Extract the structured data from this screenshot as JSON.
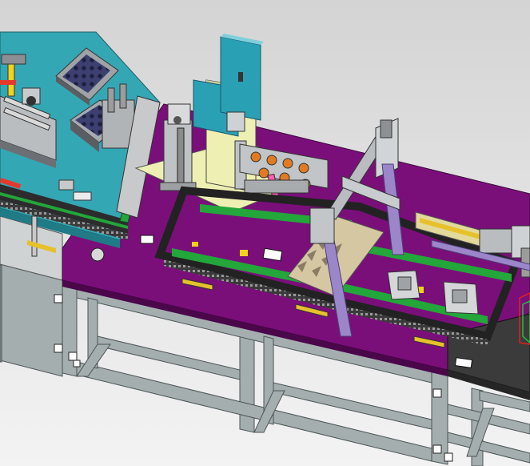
{
  "viewport": {
    "background": {
      "top": "#d4d4d4",
      "bottom": "#f3f3f3"
    }
  },
  "model": {
    "description_colors": {
      "table_top": "#7a0f7a",
      "frame": "#9aa4a6",
      "left_panel": "#34a7b4",
      "rail_green": "#23a63a",
      "rail_dark": "#2a2a2a",
      "yellow_pad": "#eef0b3",
      "lavender": "#9a86c9",
      "tan": "#d6c7a3",
      "steel": "#8c8c8c",
      "dark_end": "#3d3d3d"
    }
  }
}
